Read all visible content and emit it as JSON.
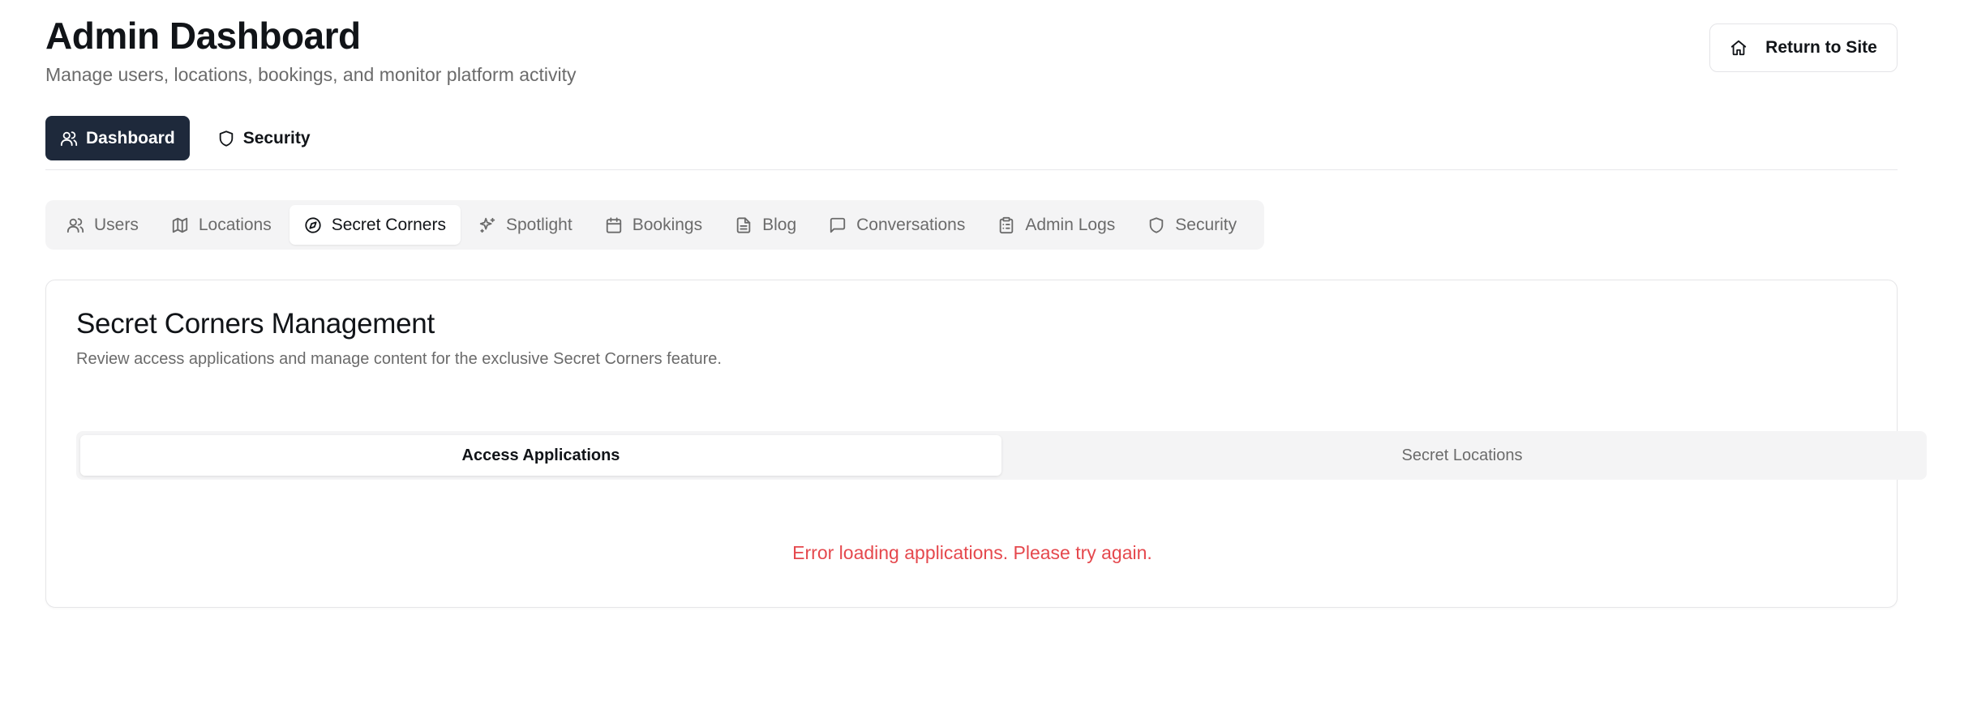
{
  "header": {
    "title": "Admin Dashboard",
    "subtitle": "Manage users, locations, bookings, and monitor platform activity",
    "return_label": "Return to Site"
  },
  "top_nav": {
    "dashboard_label": "Dashboard",
    "security_label": "Security",
    "active": "Dashboard"
  },
  "tabs": [
    {
      "label": "Users",
      "icon": "users-icon"
    },
    {
      "label": "Locations",
      "icon": "map-icon"
    },
    {
      "label": "Secret Corners",
      "icon": "compass-icon"
    },
    {
      "label": "Spotlight",
      "icon": "sparkles-icon"
    },
    {
      "label": "Bookings",
      "icon": "calendar-icon"
    },
    {
      "label": "Blog",
      "icon": "file-text-icon"
    },
    {
      "label": "Conversations",
      "icon": "message-square-icon"
    },
    {
      "label": "Admin Logs",
      "icon": "clipboard-list-icon"
    },
    {
      "label": "Security",
      "icon": "shield-icon"
    }
  ],
  "active_tab": "Secret Corners",
  "card": {
    "title": "Secret Corners Management",
    "description": "Review access applications and manage content for the exclusive Secret Corners feature.",
    "subtabs": [
      "Access Applications",
      "Secret Locations"
    ],
    "active_subtab": "Access Applications",
    "error_message": "Error loading applications. Please try again."
  },
  "colors": {
    "primary_dark": "#1e293b",
    "error": "#e5484d",
    "muted_text": "#6b6b6b",
    "tab_bg": "#f4f4f5"
  }
}
